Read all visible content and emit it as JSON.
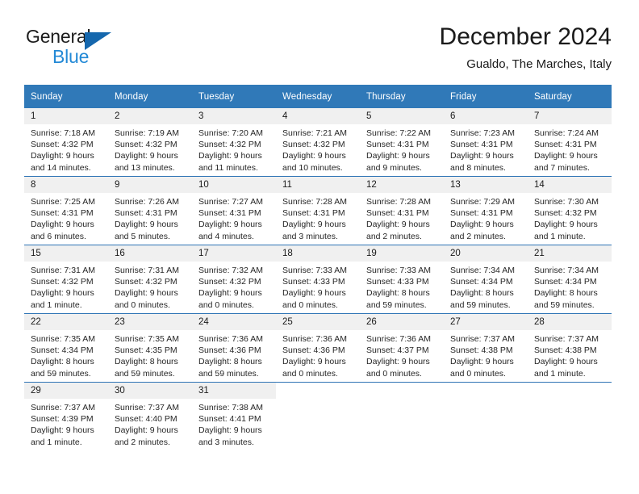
{
  "logo": {
    "line1": "General",
    "line2": "Blue",
    "triangle_color": "#1567ad",
    "blue_text_color": "#2389d6"
  },
  "header": {
    "month_title": "December 2024",
    "location": "Gualdo, The Marches, Italy"
  },
  "calendar": {
    "header_bg": "#3079b8",
    "row_divider_color": "#2e74b5",
    "daynum_bg": "#f0f0f0",
    "weekdays": [
      "Sunday",
      "Monday",
      "Tuesday",
      "Wednesday",
      "Thursday",
      "Friday",
      "Saturday"
    ],
    "weeks": [
      [
        {
          "day": "1",
          "sunrise": "Sunrise: 7:18 AM",
          "sunset": "Sunset: 4:32 PM",
          "daylight1": "Daylight: 9 hours",
          "daylight2": "and 14 minutes."
        },
        {
          "day": "2",
          "sunrise": "Sunrise: 7:19 AM",
          "sunset": "Sunset: 4:32 PM",
          "daylight1": "Daylight: 9 hours",
          "daylight2": "and 13 minutes."
        },
        {
          "day": "3",
          "sunrise": "Sunrise: 7:20 AM",
          "sunset": "Sunset: 4:32 PM",
          "daylight1": "Daylight: 9 hours",
          "daylight2": "and 11 minutes."
        },
        {
          "day": "4",
          "sunrise": "Sunrise: 7:21 AM",
          "sunset": "Sunset: 4:32 PM",
          "daylight1": "Daylight: 9 hours",
          "daylight2": "and 10 minutes."
        },
        {
          "day": "5",
          "sunrise": "Sunrise: 7:22 AM",
          "sunset": "Sunset: 4:31 PM",
          "daylight1": "Daylight: 9 hours",
          "daylight2": "and 9 minutes."
        },
        {
          "day": "6",
          "sunrise": "Sunrise: 7:23 AM",
          "sunset": "Sunset: 4:31 PM",
          "daylight1": "Daylight: 9 hours",
          "daylight2": "and 8 minutes."
        },
        {
          "day": "7",
          "sunrise": "Sunrise: 7:24 AM",
          "sunset": "Sunset: 4:31 PM",
          "daylight1": "Daylight: 9 hours",
          "daylight2": "and 7 minutes."
        }
      ],
      [
        {
          "day": "8",
          "sunrise": "Sunrise: 7:25 AM",
          "sunset": "Sunset: 4:31 PM",
          "daylight1": "Daylight: 9 hours",
          "daylight2": "and 6 minutes."
        },
        {
          "day": "9",
          "sunrise": "Sunrise: 7:26 AM",
          "sunset": "Sunset: 4:31 PM",
          "daylight1": "Daylight: 9 hours",
          "daylight2": "and 5 minutes."
        },
        {
          "day": "10",
          "sunrise": "Sunrise: 7:27 AM",
          "sunset": "Sunset: 4:31 PM",
          "daylight1": "Daylight: 9 hours",
          "daylight2": "and 4 minutes."
        },
        {
          "day": "11",
          "sunrise": "Sunrise: 7:28 AM",
          "sunset": "Sunset: 4:31 PM",
          "daylight1": "Daylight: 9 hours",
          "daylight2": "and 3 minutes."
        },
        {
          "day": "12",
          "sunrise": "Sunrise: 7:28 AM",
          "sunset": "Sunset: 4:31 PM",
          "daylight1": "Daylight: 9 hours",
          "daylight2": "and 2 minutes."
        },
        {
          "day": "13",
          "sunrise": "Sunrise: 7:29 AM",
          "sunset": "Sunset: 4:31 PM",
          "daylight1": "Daylight: 9 hours",
          "daylight2": "and 2 minutes."
        },
        {
          "day": "14",
          "sunrise": "Sunrise: 7:30 AM",
          "sunset": "Sunset: 4:32 PM",
          "daylight1": "Daylight: 9 hours",
          "daylight2": "and 1 minute."
        }
      ],
      [
        {
          "day": "15",
          "sunrise": "Sunrise: 7:31 AM",
          "sunset": "Sunset: 4:32 PM",
          "daylight1": "Daylight: 9 hours",
          "daylight2": "and 1 minute."
        },
        {
          "day": "16",
          "sunrise": "Sunrise: 7:31 AM",
          "sunset": "Sunset: 4:32 PM",
          "daylight1": "Daylight: 9 hours",
          "daylight2": "and 0 minutes."
        },
        {
          "day": "17",
          "sunrise": "Sunrise: 7:32 AM",
          "sunset": "Sunset: 4:32 PM",
          "daylight1": "Daylight: 9 hours",
          "daylight2": "and 0 minutes."
        },
        {
          "day": "18",
          "sunrise": "Sunrise: 7:33 AM",
          "sunset": "Sunset: 4:33 PM",
          "daylight1": "Daylight: 9 hours",
          "daylight2": "and 0 minutes."
        },
        {
          "day": "19",
          "sunrise": "Sunrise: 7:33 AM",
          "sunset": "Sunset: 4:33 PM",
          "daylight1": "Daylight: 8 hours",
          "daylight2": "and 59 minutes."
        },
        {
          "day": "20",
          "sunrise": "Sunrise: 7:34 AM",
          "sunset": "Sunset: 4:34 PM",
          "daylight1": "Daylight: 8 hours",
          "daylight2": "and 59 minutes."
        },
        {
          "day": "21",
          "sunrise": "Sunrise: 7:34 AM",
          "sunset": "Sunset: 4:34 PM",
          "daylight1": "Daylight: 8 hours",
          "daylight2": "and 59 minutes."
        }
      ],
      [
        {
          "day": "22",
          "sunrise": "Sunrise: 7:35 AM",
          "sunset": "Sunset: 4:34 PM",
          "daylight1": "Daylight: 8 hours",
          "daylight2": "and 59 minutes."
        },
        {
          "day": "23",
          "sunrise": "Sunrise: 7:35 AM",
          "sunset": "Sunset: 4:35 PM",
          "daylight1": "Daylight: 8 hours",
          "daylight2": "and 59 minutes."
        },
        {
          "day": "24",
          "sunrise": "Sunrise: 7:36 AM",
          "sunset": "Sunset: 4:36 PM",
          "daylight1": "Daylight: 8 hours",
          "daylight2": "and 59 minutes."
        },
        {
          "day": "25",
          "sunrise": "Sunrise: 7:36 AM",
          "sunset": "Sunset: 4:36 PM",
          "daylight1": "Daylight: 9 hours",
          "daylight2": "and 0 minutes."
        },
        {
          "day": "26",
          "sunrise": "Sunrise: 7:36 AM",
          "sunset": "Sunset: 4:37 PM",
          "daylight1": "Daylight: 9 hours",
          "daylight2": "and 0 minutes."
        },
        {
          "day": "27",
          "sunrise": "Sunrise: 7:37 AM",
          "sunset": "Sunset: 4:38 PM",
          "daylight1": "Daylight: 9 hours",
          "daylight2": "and 0 minutes."
        },
        {
          "day": "28",
          "sunrise": "Sunrise: 7:37 AM",
          "sunset": "Sunset: 4:38 PM",
          "daylight1": "Daylight: 9 hours",
          "daylight2": "and 1 minute."
        }
      ],
      [
        {
          "day": "29",
          "sunrise": "Sunrise: 7:37 AM",
          "sunset": "Sunset: 4:39 PM",
          "daylight1": "Daylight: 9 hours",
          "daylight2": "and 1 minute."
        },
        {
          "day": "30",
          "sunrise": "Sunrise: 7:37 AM",
          "sunset": "Sunset: 4:40 PM",
          "daylight1": "Daylight: 9 hours",
          "daylight2": "and 2 minutes."
        },
        {
          "day": "31",
          "sunrise": "Sunrise: 7:38 AM",
          "sunset": "Sunset: 4:41 PM",
          "daylight1": "Daylight: 9 hours",
          "daylight2": "and 3 minutes."
        },
        {
          "day": "",
          "sunrise": "",
          "sunset": "",
          "daylight1": "",
          "daylight2": ""
        },
        {
          "day": "",
          "sunrise": "",
          "sunset": "",
          "daylight1": "",
          "daylight2": ""
        },
        {
          "day": "",
          "sunrise": "",
          "sunset": "",
          "daylight1": "",
          "daylight2": ""
        },
        {
          "day": "",
          "sunrise": "",
          "sunset": "",
          "daylight1": "",
          "daylight2": ""
        }
      ]
    ]
  }
}
